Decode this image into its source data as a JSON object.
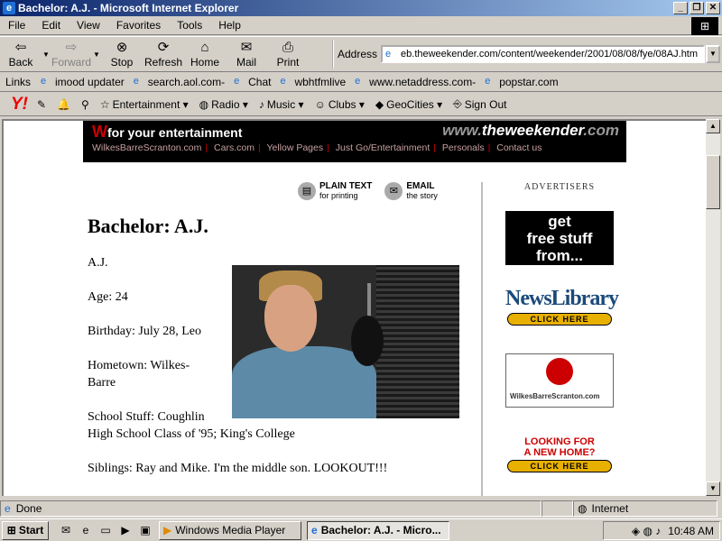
{
  "window": {
    "title": "Bachelor: A.J. - Microsoft Internet Explorer"
  },
  "menu": [
    "File",
    "Edit",
    "View",
    "Favorites",
    "Tools",
    "Help"
  ],
  "toolbar": {
    "back": "Back",
    "forward": "Forward",
    "stop": "Stop",
    "refresh": "Refresh",
    "home": "Home",
    "mail": "Mail",
    "print": "Print"
  },
  "address": {
    "label": "Address",
    "url": "eb.theweekender.com/content/weekender/2001/08/08/fye/08AJ.htm"
  },
  "links": {
    "label": "Links",
    "items": [
      "imood updater",
      "search.aol.com-",
      "Chat",
      "wbhtfmlive",
      "www.netaddress.com-",
      "popstar.com"
    ]
  },
  "yahoo": {
    "items": [
      "Entertainment",
      "Radio",
      "Music",
      "Clubs",
      "GeoCities",
      "Sign Out"
    ]
  },
  "banner": {
    "tagline": "for your entertainment",
    "site_prefix": "www.",
    "site_main": "theweekender",
    "site_suffix": ".com",
    "nav": [
      "WilkesBarreScranton.com",
      "Cars.com",
      "Yellow Pages",
      "Just Go/Entertainment",
      "Personals",
      "Contact us"
    ]
  },
  "tools": {
    "plain_title": "PLAIN TEXT",
    "plain_sub": "for printing",
    "email_title": "EMAIL",
    "email_sub": "the story"
  },
  "article": {
    "title": "Bachelor: A.J.",
    "name": "A.J.",
    "age": "Age: 24",
    "birthday": "Birthday: July 28, Leo",
    "hometown_1": "Hometown: Wilkes-",
    "hometown_2": "Barre",
    "school_1": "School Stuff: Coughlin",
    "school_2": "High School Class of '95; King's College",
    "siblings": "Siblings: Ray and Mike. I'm the middle son. LOOKOUT!!!"
  },
  "ads": {
    "header": "ADVERTISERS",
    "ad1_1": "get",
    "ad1_2": "free stuff",
    "ad1_3": "from...",
    "newslibrary": "NewsLibrary",
    "click": "CLICK HERE",
    "wbs": "WilkesBarreScranton.com",
    "home_1": "LOOKING FOR",
    "home_2": "A NEW HOME?"
  },
  "status": {
    "text": "Done",
    "zone": "Internet"
  },
  "taskbar": {
    "start": "Start",
    "tasks": [
      "Windows Media Player",
      "Bachelor: A.J. - Micro..."
    ],
    "clock": "10:48 AM"
  }
}
